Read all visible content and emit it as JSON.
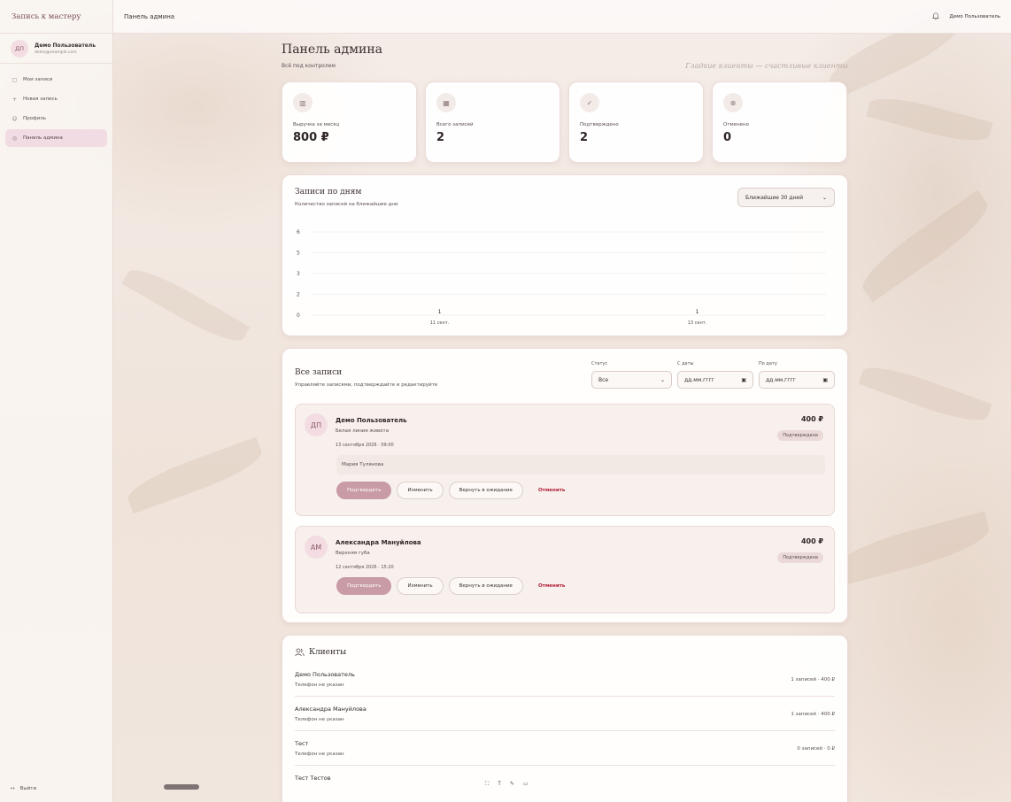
{
  "app": {
    "brand": "Запись к мастеру",
    "topbar_title": "Панель админа",
    "topbar_user": "Демо Пользователь"
  },
  "user": {
    "initials": "ДП",
    "name": "Демо Пользователь",
    "email": "demo@example.com"
  },
  "sidebar": {
    "items": [
      {
        "label": "Мои записи",
        "icon": "calendar-icon"
      },
      {
        "label": "Новая запись",
        "icon": "plus-icon"
      },
      {
        "label": "Профиль",
        "icon": "user-icon"
      },
      {
        "label": "Панель админа",
        "icon": "shield-icon"
      }
    ],
    "logout": "Выйти"
  },
  "page": {
    "title": "Панель админа",
    "subtitle": "Всё под контролем",
    "tagline": "Гладкие клиенты — счастливые клиенты"
  },
  "stats": [
    {
      "label": "Выручка за месяц",
      "value": "800 ₽",
      "icon": "chart-icon"
    },
    {
      "label": "Всего записей",
      "value": "2",
      "icon": "calendar-icon"
    },
    {
      "label": "Подтверждено",
      "value": "2",
      "icon": "check-circle-icon"
    },
    {
      "label": "Отменено",
      "value": "0",
      "icon": "x-circle-icon"
    }
  ],
  "chart_section": {
    "title": "Записи по дням",
    "subtitle": "Количество записей на ближайшие дни",
    "range_select": "Ближайшие 30 дней"
  },
  "chart_data": {
    "type": "bar",
    "categories": [
      "11 сент.",
      "13 сент."
    ],
    "values": [
      1,
      1
    ],
    "yticks": [
      "0",
      "2",
      "3",
      "5",
      "6"
    ],
    "ylim": [
      0,
      6
    ],
    "grid": true,
    "data_labels": [
      "1",
      "1"
    ]
  },
  "records": {
    "title": "Все записи",
    "subtitle": "Управляйте записями, подтверждайте и редактируйте",
    "filters": {
      "status_label": "Статус",
      "status_value": "Все",
      "from_label": "С даты",
      "from_value": "дд.мм.гггг",
      "to_label": "По дату",
      "to_value": "дд.мм.гггг"
    },
    "items": [
      {
        "initials": "ДП",
        "name": "Демо Пользователь",
        "service": "Белая линия живота",
        "date": "13 сентября 2026 · 09:00",
        "price": "400 ₽",
        "status": "Подтверждена",
        "note": "Мария Тулянова"
      },
      {
        "initials": "АМ",
        "name": "Александра Мануйлова",
        "service": "Верхняя губа",
        "date": "12 сентября 2026 · 15:20",
        "price": "400 ₽",
        "status": "Подтверждена"
      }
    ],
    "actions": {
      "confirm": "Подтвердить",
      "edit": "Изменить",
      "pending": "Вернуть в ожидание",
      "cancel": "Отменить"
    }
  },
  "clients": {
    "title": "Клиенты",
    "items": [
      {
        "name": "Демо Пользователь",
        "phone": "Телефон не указан",
        "stats": "1 записей · 400 ₽"
      },
      {
        "name": "Александра Мануйлова",
        "phone": "Телефон не указан",
        "stats": "1 записей · 400 ₽"
      },
      {
        "name": "Тест",
        "phone": "Телефон не указан",
        "stats": "0 записей · 0 ₽"
      },
      {
        "name": "Тест Тестов"
      }
    ]
  }
}
